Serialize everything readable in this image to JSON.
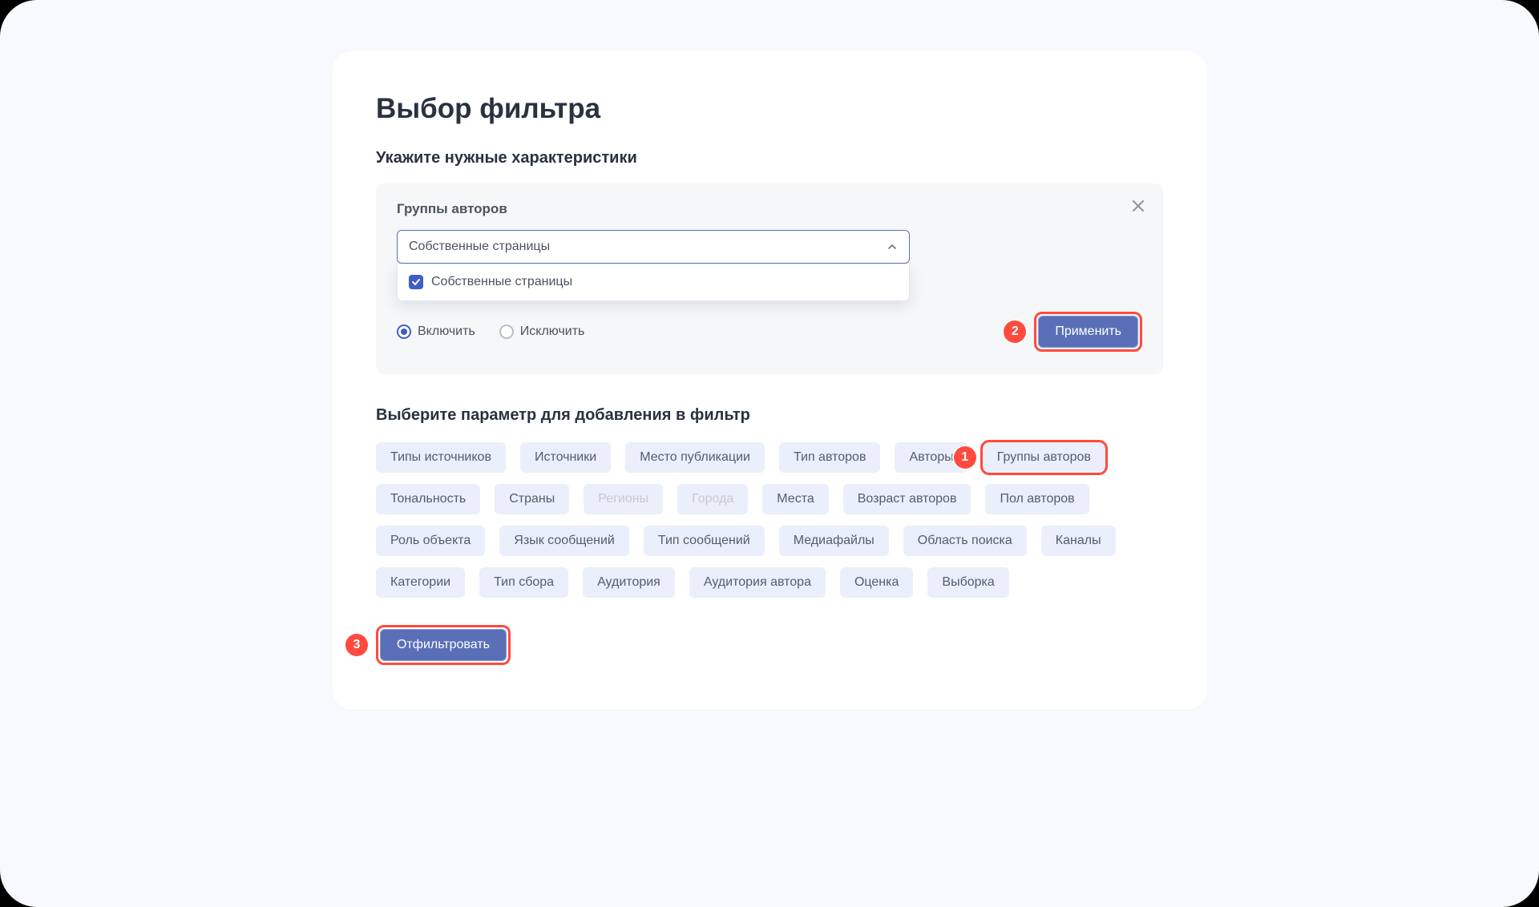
{
  "title": "Выбор фильтра",
  "subtitle": "Укажите нужные характеристики",
  "panel": {
    "label": "Группы авторов",
    "select_value": "Собственные страницы",
    "option_label": "Собственные страницы",
    "option_checked": true,
    "radio_include": "Включить",
    "radio_exclude": "Исключить",
    "radio_selected": "include",
    "apply_label": "Применить"
  },
  "params_title": "Выберите параметр для добавления в фильтр",
  "chips": [
    {
      "label": "Типы источников",
      "disabled": false
    },
    {
      "label": "Источники",
      "disabled": false
    },
    {
      "label": "Место публикации",
      "disabled": false
    },
    {
      "label": "Тип авторов",
      "disabled": false
    },
    {
      "label": "Авторы",
      "disabled": false
    },
    {
      "label": "Группы авторов",
      "disabled": false,
      "highlight": 1
    },
    {
      "label": "Тональность",
      "disabled": false
    },
    {
      "label": "Страны",
      "disabled": false
    },
    {
      "label": "Регионы",
      "disabled": true
    },
    {
      "label": "Города",
      "disabled": true
    },
    {
      "label": "Места",
      "disabled": false
    },
    {
      "label": "Возраст авторов",
      "disabled": false
    },
    {
      "label": "Пол авторов",
      "disabled": false
    },
    {
      "label": "Роль объекта",
      "disabled": false
    },
    {
      "label": "Язык сообщений",
      "disabled": false
    },
    {
      "label": "Тип сообщений",
      "disabled": false
    },
    {
      "label": "Медиафайлы",
      "disabled": false
    },
    {
      "label": "Область поиска",
      "disabled": false
    },
    {
      "label": "Каналы",
      "disabled": false
    },
    {
      "label": "Категории",
      "disabled": false
    },
    {
      "label": "Тип сбора",
      "disabled": false
    },
    {
      "label": "Аудитория",
      "disabled": false
    },
    {
      "label": "Аудитория автора",
      "disabled": false
    },
    {
      "label": "Оценка",
      "disabled": false
    },
    {
      "label": "Выборка",
      "disabled": false
    }
  ],
  "filter_button": "Отфильтровать",
  "badges": {
    "apply": "2",
    "chip": "1",
    "filter": "3"
  }
}
